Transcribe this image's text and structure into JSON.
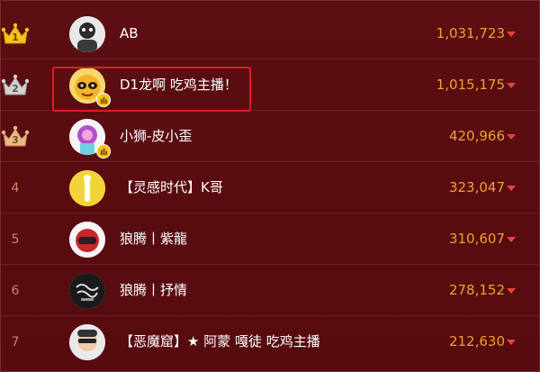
{
  "leaderboard": [
    {
      "rank": "1",
      "name": "AB",
      "score": "1,031,723",
      "crown": "gold"
    },
    {
      "rank": "2",
      "name": "D1龙啊 吃鸡主播！",
      "score": "1,015,175",
      "crown": "silver"
    },
    {
      "rank": "3",
      "name": "小狮-皮小歪",
      "score": "420,966",
      "crown": "bronze"
    },
    {
      "rank": "4",
      "name": "【灵感时代】K哥",
      "score": "323,047"
    },
    {
      "rank": "5",
      "name": "狼腾丨紫龍",
      "score": "310,607"
    },
    {
      "rank": "6",
      "name": "狼腾丨抒情",
      "score": "278,152"
    },
    {
      "rank": "7",
      "name": "【恶魔窟】★ 阿蒙 嘎徒 吃鸡主播",
      "score": "212,630"
    }
  ],
  "colors": {
    "background": "#5a0d10",
    "score": "#f0a030",
    "arrow": "#e8443c",
    "highlight": "#e31b23",
    "gold": "#f5c518",
    "silver": "#c9c9c9",
    "bronze": "#e8b889"
  }
}
